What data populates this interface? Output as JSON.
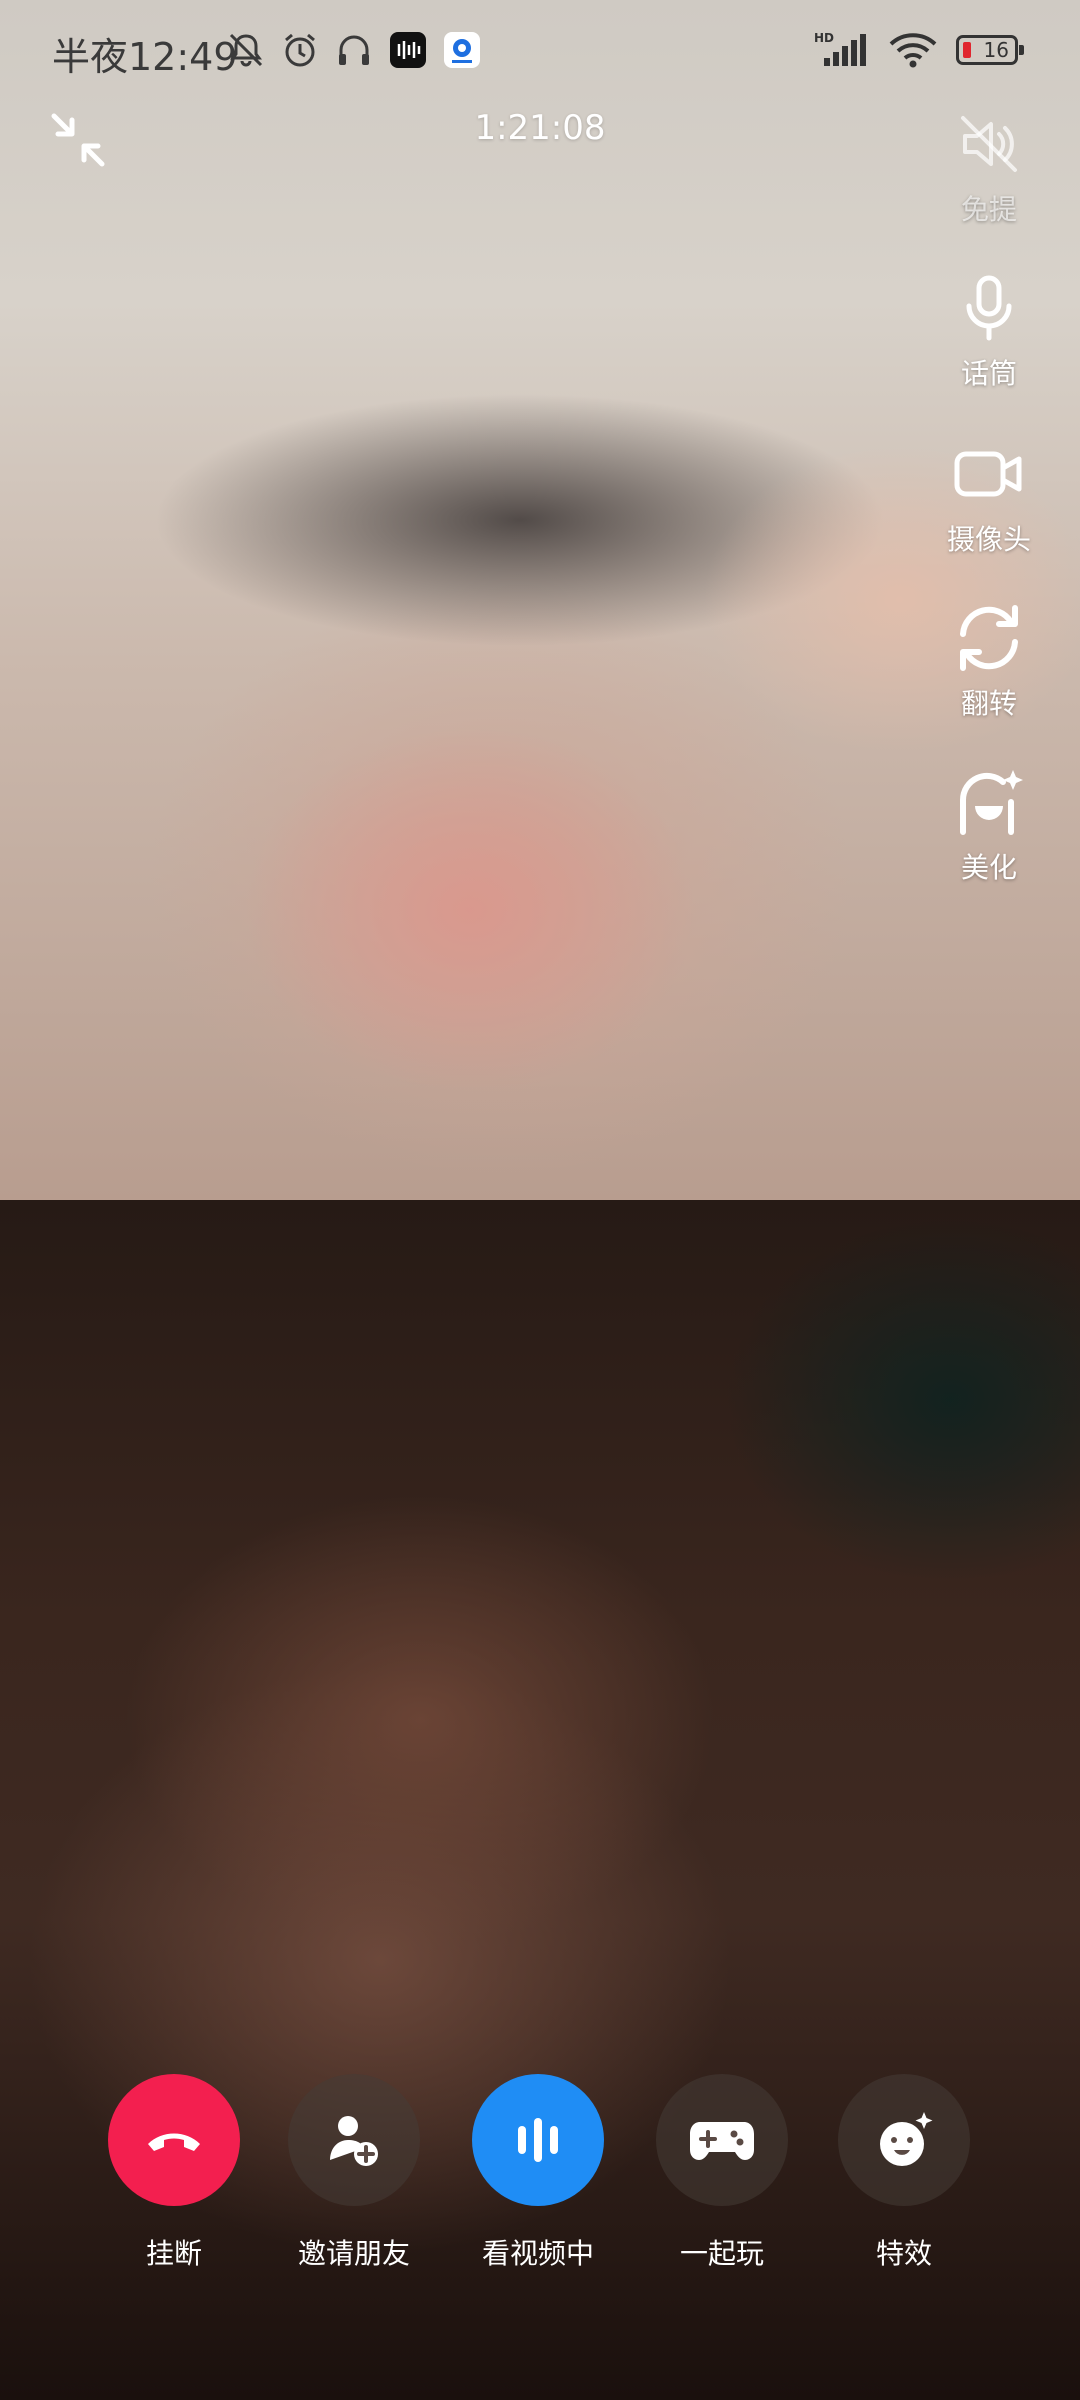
{
  "status_bar": {
    "time": "半夜12:49",
    "battery_level": "16",
    "network_badge": "HD",
    "battery_color": "#e0262e"
  },
  "call": {
    "timer": "1:21:08"
  },
  "side_controls": {
    "speaker_label": "免提",
    "mic_label": "话筒",
    "camera_label": "摄像头",
    "flip_label": "翻转",
    "beauty_label": "美化"
  },
  "bottom_actions": {
    "hangup_label": "挂断",
    "invite_label": "邀请朋友",
    "watch_label": "看视频中",
    "play_label": "一起玩",
    "effects_label": "特效"
  },
  "colors": {
    "hangup": "#f31f4f",
    "watch_active": "#1f8df5"
  }
}
